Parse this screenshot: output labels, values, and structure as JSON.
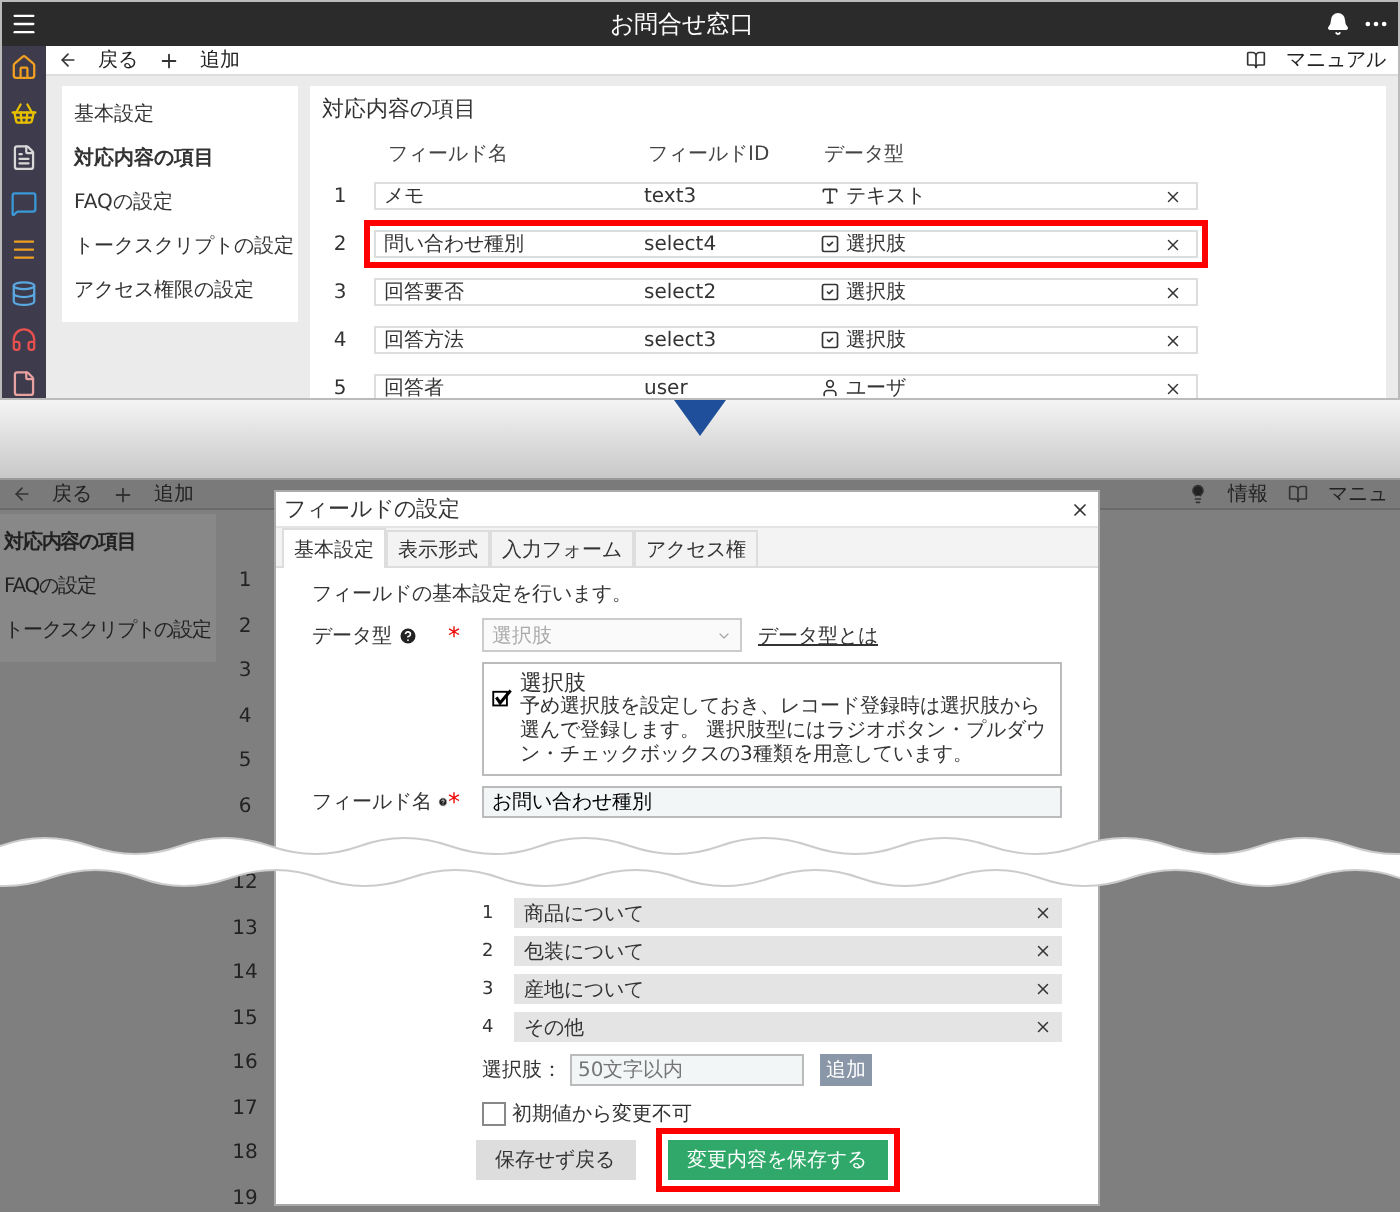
{
  "before": {
    "window": {
      "title": "お問合せ窓口"
    },
    "toolbar": {
      "back": "戻る",
      "add": "追加",
      "manual": "マニュアル"
    },
    "rail": [
      {
        "kind": "home",
        "color": "#f0a020"
      },
      {
        "kind": "basket",
        "color": "#e8c000"
      },
      {
        "kind": "document",
        "color": "#d8d8d8"
      },
      {
        "kind": "chat",
        "color": "#3a9ad8"
      },
      {
        "kind": "list",
        "color": "#f0a020"
      },
      {
        "kind": "database",
        "color": "#5aa8e0"
      },
      {
        "kind": "headset",
        "color": "#e85050"
      },
      {
        "kind": "file",
        "color": "#e8a0a0"
      }
    ],
    "menu": [
      {
        "label": "基本設定",
        "selected": false
      },
      {
        "label": "対応内容の項目",
        "selected": true
      },
      {
        "label": "FAQの設定",
        "selected": false
      },
      {
        "label": "トークスクリプトの設定",
        "selected": false
      },
      {
        "label": "アクセス権限の設定",
        "selected": false
      }
    ],
    "panel_title": "対応内容の項目",
    "columns": [
      "フィールド名",
      "フィールドID",
      "データ型"
    ],
    "rows": [
      {
        "number": "1",
        "name": "メモ",
        "id": "text3",
        "kind": "text",
        "type": "テキスト",
        "highlighted": false
      },
      {
        "number": "2",
        "name": "問い合わせ種別",
        "id": "select4",
        "kind": "choice",
        "type": "選択肢",
        "highlighted": true
      },
      {
        "number": "3",
        "name": "回答要否",
        "id": "select2",
        "kind": "choice",
        "type": "選択肢",
        "highlighted": false
      },
      {
        "number": "4",
        "name": "回答方法",
        "id": "select3",
        "kind": "choice",
        "type": "選択肢",
        "highlighted": false
      },
      {
        "number": "5",
        "name": "回答者",
        "id": "user",
        "kind": "user",
        "type": "ユーザ",
        "highlighted": false
      }
    ]
  },
  "after": {
    "toolbar": {
      "back": "戻る",
      "add": "追加",
      "info": "情報",
      "manual": "マニュ"
    },
    "menu": [
      {
        "label": "対応内容の項目",
        "selected": true
      },
      {
        "label": "FAQの設定",
        "selected": false
      },
      {
        "label": "トークスクリプトの設定",
        "selected": false
      }
    ],
    "row_numbers_before_cut": [
      "1",
      "2",
      "3",
      "4",
      "5",
      "6"
    ],
    "row_numbers_after_cut": [
      "12",
      "13",
      "14",
      "15",
      "16",
      "17",
      "18",
      "19"
    ],
    "dialog": {
      "title": "フィールドの設定",
      "tabs": [
        {
          "label": "基本設定",
          "selected": true
        },
        {
          "label": "表示形式",
          "selected": false
        },
        {
          "label": "入力フォーム",
          "selected": false
        },
        {
          "label": "アクセス権",
          "selected": false
        }
      ],
      "description": "フィールドの基本設定を行います。",
      "data_type": {
        "label": "データ型",
        "required": true,
        "required_mark": "*",
        "value": "選択肢",
        "disabled": true,
        "link": "データ型とは"
      },
      "info": {
        "heading": "選択肢",
        "text": "予め選択肢を設定しておき、レコード登録時は選択肢から選んで登録します。 選択肢型にはラジオボタン・プルダウン・チェックボックスの3種類を用意しています。"
      },
      "field_name": {
        "label": "フィールド名",
        "required": true,
        "required_mark": "*",
        "value": "お問い合わせ種別"
      },
      "choices": [
        {
          "number": "1",
          "label": "商品について"
        },
        {
          "number": "2",
          "label": "包装について"
        },
        {
          "number": "3",
          "label": "産地について"
        },
        {
          "number": "4",
          "label": "その他"
        }
      ],
      "new_choice": {
        "label": "選択肢：",
        "placeholder": "50文字以内",
        "button": "追加"
      },
      "fixed_default": {
        "label": "初期値から変更不可",
        "checked": false
      },
      "cancel": "保存せず戻る",
      "save": {
        "label": "変更内容を保存する",
        "highlighted": true
      }
    }
  }
}
